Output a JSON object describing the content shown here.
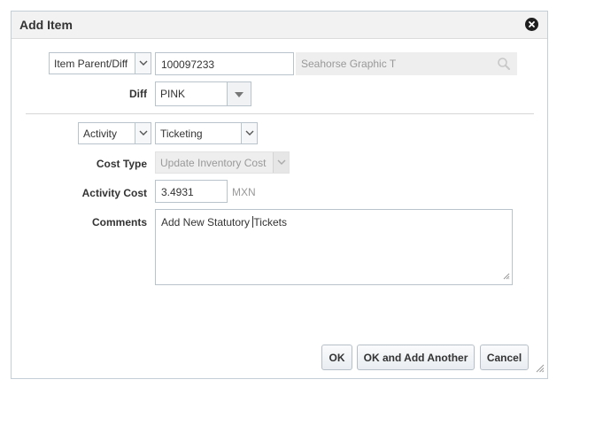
{
  "dialog": {
    "title": "Add Item",
    "close_icon": "close-circle-icon"
  },
  "item_type": {
    "selected": "Item Parent/Diff",
    "value": "100097233",
    "description": "Seahorse Graphic T",
    "search_icon": "search-icon"
  },
  "diff": {
    "label": "Diff",
    "selected": "PINK"
  },
  "activity": {
    "selected": "Activity",
    "activity_value": "Ticketing"
  },
  "cost_type": {
    "label": "Cost Type",
    "value": "Update Inventory Cost"
  },
  "activity_cost": {
    "label": "Activity Cost",
    "value": "3.4931",
    "currency": "MXN"
  },
  "comments": {
    "label": "Comments",
    "text_before_caret": "Add New Statutory ",
    "text_after_caret": "Tickets"
  },
  "buttons": {
    "ok": "OK",
    "ok_add_another": "OK and Add Another",
    "cancel": "Cancel"
  },
  "colors": {
    "header_bg": "#f2f2f2",
    "border": "#b9c3cc",
    "readonly_bg": "#eeeeee"
  }
}
